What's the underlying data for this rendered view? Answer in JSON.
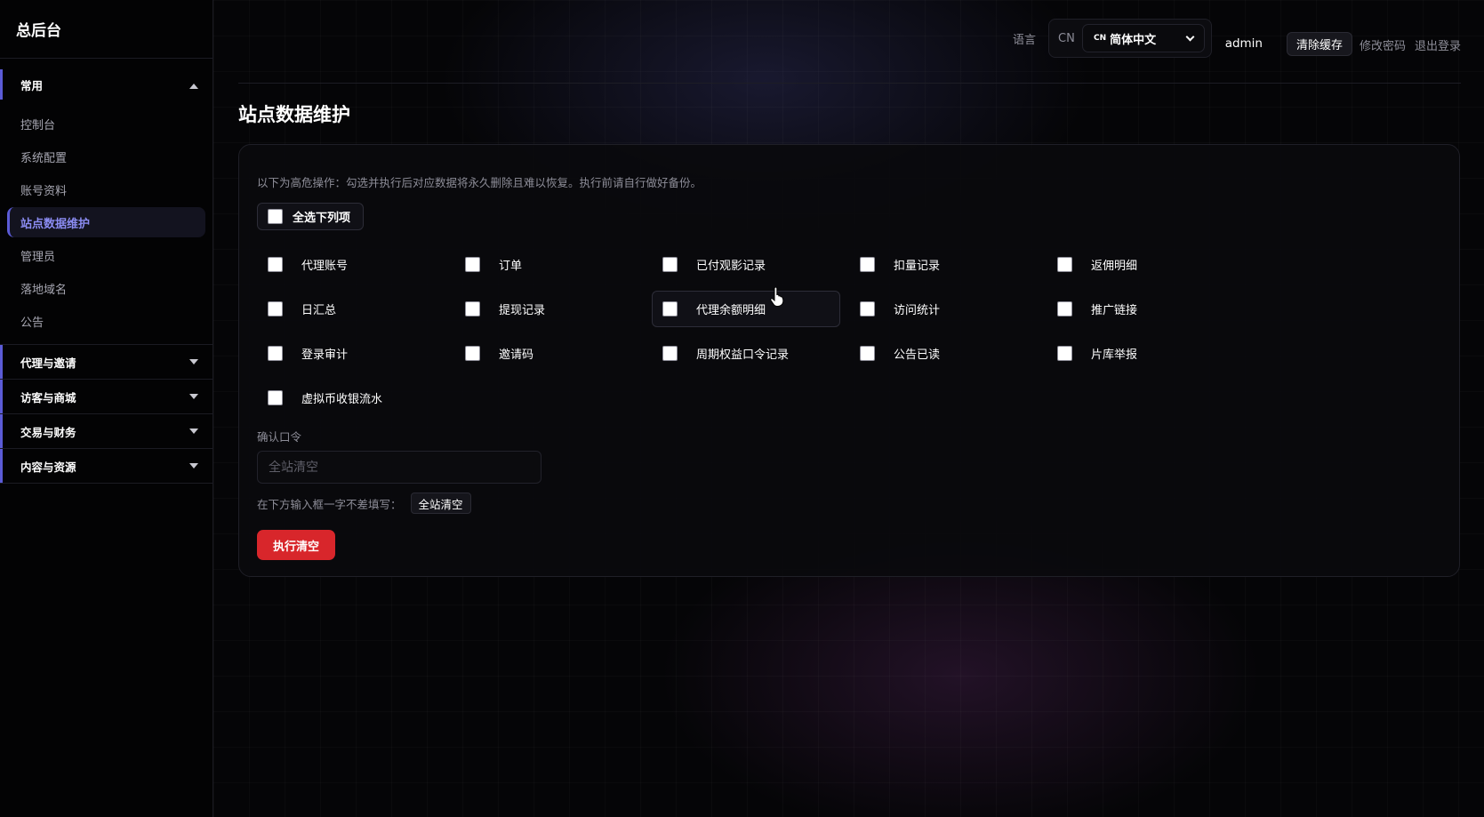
{
  "sidebar": {
    "brand": "总后台",
    "groups": [
      {
        "label": "常用",
        "items": [
          {
            "label": "控制台"
          },
          {
            "label": "系统配置"
          },
          {
            "label": "账号资料"
          },
          {
            "label": "站点数据维护"
          },
          {
            "label": "管理员"
          },
          {
            "label": "落地域名"
          },
          {
            "label": "公告"
          }
        ]
      },
      {
        "label": "代理与邀请"
      },
      {
        "label": "访客与商城"
      },
      {
        "label": "交易与财务"
      },
      {
        "label": "内容与资源"
      }
    ]
  },
  "topbar": {
    "language_label": "语言",
    "language_prefix": "CN",
    "language_code": "CN",
    "language_value": "简体中文",
    "username": "admin",
    "clear_cache": "清除缓存",
    "change_password": "修改密码",
    "logout": "退出登录"
  },
  "page": {
    "title": "站点数据维护",
    "warning": "以下为高危操作：勾选并执行后对应数据将永久删除且难以恢复。执行前请自行做好备份。",
    "select_all": "全选下列项",
    "options": [
      "代理账号",
      "订单",
      "已付观影记录",
      "扣量记录",
      "返佣明细",
      "日汇总",
      "提现记录",
      "代理余额明细",
      "访问统计",
      "推广链接",
      "登录审计",
      "邀请码",
      "周期权益口令记录",
      "公告已读",
      "片库举报",
      "虚拟币收银流水"
    ],
    "confirm_label": "确认口令",
    "confirm_placeholder": "全站清空",
    "hint_text": "在下方输入框一字不差填写：",
    "hint_code": "全站清空",
    "execute": "执行清空"
  },
  "colors": {
    "accent": "#5b5bd6",
    "active_text": "#8b8cf2",
    "danger": "#d8262b"
  }
}
